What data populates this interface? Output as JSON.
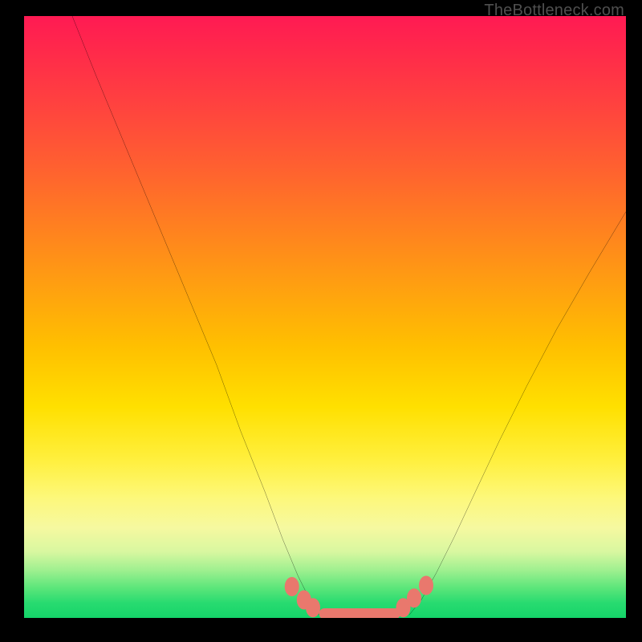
{
  "attribution": "TheBottleneck.com",
  "chart_data": {
    "type": "line",
    "title": "",
    "xlabel": "",
    "ylabel": "",
    "xlim": [
      0,
      100
    ],
    "ylim": [
      0,
      100
    ],
    "series": [
      {
        "name": "left-curve",
        "x": [
          8,
          12,
          17,
          22,
          27,
          32,
          36,
          40,
          43,
          45.5,
          47.5,
          49
        ],
        "y": [
          100,
          90,
          78,
          66,
          54,
          42,
          31,
          21,
          13,
          7,
          3,
          0.5
        ]
      },
      {
        "name": "right-curve",
        "x": [
          64,
          66,
          68.5,
          71.5,
          75,
          79,
          83.5,
          88.5,
          94,
          100
        ],
        "y": [
          0.5,
          3,
          7.5,
          13.5,
          21,
          29.5,
          38.5,
          48,
          57.5,
          67.5
        ]
      }
    ],
    "floor_markers": {
      "note": "coral ellipses and bar near chart floor",
      "ellipses_x": [
        44.5,
        46.5,
        48.0,
        63.0,
        64.8,
        66.8
      ],
      "ellipses_y": [
        5.2,
        3.0,
        1.7,
        1.7,
        3.3,
        5.4
      ],
      "bar": {
        "x0": 49.0,
        "x1": 62.5,
        "y": 0.7
      },
      "color": "#e9786d"
    },
    "background_gradient": {
      "direction": "top-to-bottom",
      "stops": [
        {
          "pos": 0,
          "color": "#ff1a53"
        },
        {
          "pos": 25,
          "color": "#ff6030"
        },
        {
          "pos": 55,
          "color": "#ffc000"
        },
        {
          "pos": 80,
          "color": "#fdf87a"
        },
        {
          "pos": 95,
          "color": "#5ce67a"
        },
        {
          "pos": 100,
          "color": "#15d469"
        }
      ]
    }
  }
}
